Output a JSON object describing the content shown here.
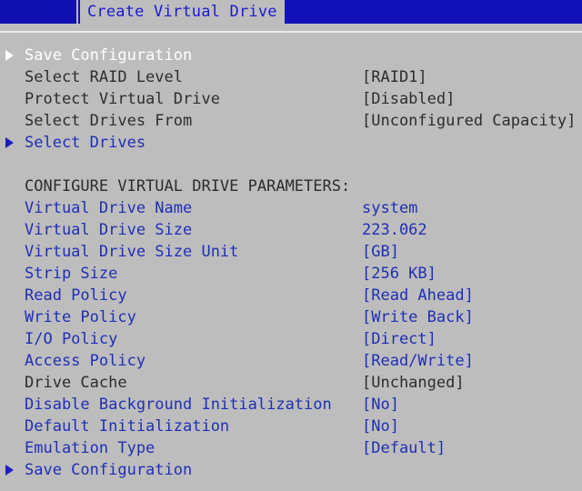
{
  "header": {
    "tab_title": "Create Virtual Drive"
  },
  "top_items": [
    {
      "label": "Save Configuration",
      "value": "",
      "arrow": true,
      "highlighted": true
    },
    {
      "label": "Select RAID Level",
      "value": "[RAID1]",
      "arrow": false
    },
    {
      "label": "Protect Virtual Drive",
      "value": "[Disabled]",
      "arrow": false
    },
    {
      "label": "Select Drives From",
      "value": "[Unconfigured Capacity]",
      "arrow": false
    },
    {
      "label": "Select Drives",
      "value": "",
      "arrow": true
    }
  ],
  "section_heading": "CONFIGURE VIRTUAL DRIVE PARAMETERS:",
  "params": [
    {
      "label": "Virtual Drive Name",
      "value": "system"
    },
    {
      "label": "Virtual Drive Size",
      "value": "223.062"
    },
    {
      "label": "Virtual Drive Size Unit",
      "value": "[GB]"
    },
    {
      "label": "Strip Size",
      "value": "[256 KB]"
    },
    {
      "label": "Read Policy",
      "value": "[Read Ahead]"
    },
    {
      "label": "Write Policy",
      "value": "[Write Back]"
    },
    {
      "label": "I/O Policy",
      "value": "[Direct]"
    },
    {
      "label": "Access Policy",
      "value": "[Read/Write]"
    },
    {
      "label": "Drive Cache",
      "value": "[Unchanged]"
    },
    {
      "label": "Disable Background Initialization",
      "value": "[No]"
    },
    {
      "label": "Default Initialization",
      "value": "[No]"
    },
    {
      "label": "Emulation Type",
      "value": "[Default]"
    }
  ],
  "footer_item": {
    "label": "Save Configuration"
  },
  "colors": {
    "background": "#bdbdbd",
    "header_bar": "#1212b8",
    "link_blue": "#1f2fb5",
    "highlight_text": "#ffffff"
  }
}
